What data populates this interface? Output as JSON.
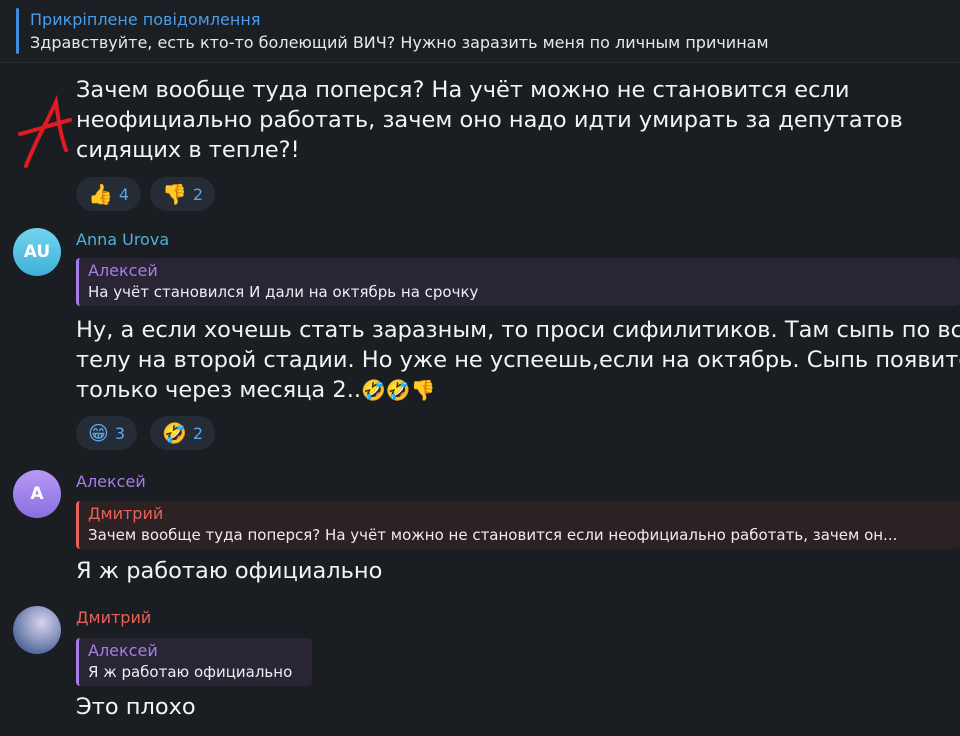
{
  "pinned": {
    "title": "Прикріплене повідомлення",
    "text": "Здравствуйте, есть кто-то болеющий ВИЧ? Нужно заразить меня по личным причинам"
  },
  "msg1": {
    "lines": [
      "Зачем вообще туда поперся? На учёт можно не становится если",
      "неофициально работать, зачем оно надо идти умирать за депутатов",
      "сидящих в тепле?!"
    ],
    "reactions": [
      {
        "icon": "thumbs-up-icon",
        "emoji": "👍",
        "count": "4"
      },
      {
        "icon": "thumbs-down-icon",
        "emoji": "👎",
        "count": "2"
      }
    ]
  },
  "msg2": {
    "avatar": "AU",
    "sender": "Anna Urova",
    "reply_name": "Алексей",
    "reply_text": "На учёт становился  И дали на октябрь на срочку",
    "lines": [
      "Ну, а если хочешь стать заразным, то проси сифилитиков. Там сыпь по всему",
      "телу на второй стадии. Но уже не успеешь,если на октябрь. Сыпь появится",
      "только через месяца 2.."
    ],
    "trailing_emoji": "🤣🤣👎",
    "reactions": [
      {
        "icon": "grinning-face-icon",
        "emoji": "😁",
        "count": "3"
      },
      {
        "icon": "rolling-laughing-icon",
        "emoji": "🤣",
        "count": "2"
      }
    ]
  },
  "msg3": {
    "avatar": "A",
    "sender": "Алексей",
    "reply_name": "Дмитрий",
    "reply_text": "Зачем вообще туда поперся? На учёт можно не становится если неофициально работать, зачем он...",
    "text": "Я ж работаю официально"
  },
  "msg4": {
    "sender": "Дмитрий",
    "reply_name": "Алексей",
    "reply_text": "Я ж работаю официально",
    "text": "Это плохо"
  },
  "colors": {
    "background": "#1a1d21",
    "accent_blue": "#4a9ee8",
    "anna": "#4fb3d9",
    "aleksey": "#a77de8",
    "dmitriy": "#e8625a",
    "annotation_red": "#e01b24"
  }
}
